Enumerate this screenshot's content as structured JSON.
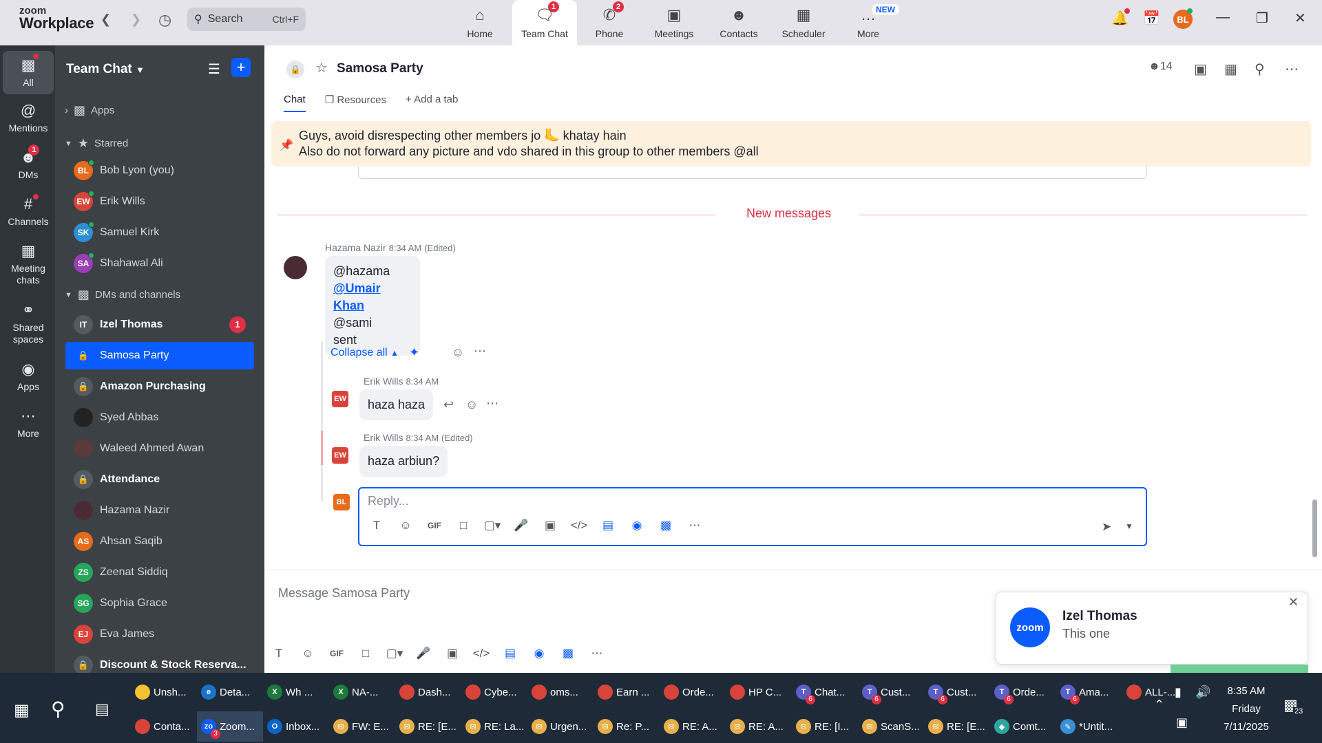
{
  "app": {
    "logo_top": "zoom",
    "logo_bottom": "Workplace"
  },
  "topbar": {
    "search_label": "Search",
    "search_shortcut": "Ctrl+F",
    "nav": [
      {
        "label": "Home",
        "icon": "home-icon",
        "badge": ""
      },
      {
        "label": "Team Chat",
        "icon": "chat-icon",
        "badge": "1"
      },
      {
        "label": "Phone",
        "icon": "phone-icon",
        "badge": "2"
      },
      {
        "label": "Meetings",
        "icon": "video-icon",
        "badge": ""
      },
      {
        "label": "Contacts",
        "icon": "contacts-icon",
        "badge": ""
      },
      {
        "label": "Scheduler",
        "icon": "calendar-icon",
        "badge": ""
      },
      {
        "label": "More",
        "icon": "more-icon",
        "badge": "",
        "tag": "NEW"
      }
    ],
    "avatar": "BL"
  },
  "rail": [
    {
      "label": "All",
      "icon": "chat-bubble-icon"
    },
    {
      "label": "Mentions",
      "icon": "at-icon"
    },
    {
      "label": "DMs",
      "icon": "people-icon",
      "badge": "1"
    },
    {
      "label": "Channels",
      "icon": "hash-icon"
    },
    {
      "label": "Meeting chats",
      "icon": "calendar-icon"
    },
    {
      "label": "Shared spaces",
      "icon": "share-icon"
    },
    {
      "label": "Apps",
      "icon": "apps-icon"
    },
    {
      "label": "More",
      "icon": "ellipsis-icon"
    }
  ],
  "sidebar": {
    "title": "Team Chat",
    "sections": {
      "apps": "Apps",
      "starred": "Starred",
      "dms": "DMs and channels"
    },
    "starred": [
      {
        "initials": "BL",
        "name": "Bob Lyon (you)",
        "color": "#e86a1b"
      },
      {
        "initials": "EW",
        "name": "Erik Wills",
        "color": "#d9443a"
      },
      {
        "initials": "SK",
        "name": "Samuel Kirk",
        "color": "#2d8fd5"
      },
      {
        "initials": "SA",
        "name": "Shahawal Ali",
        "color": "#9b3fb5"
      }
    ],
    "dms": [
      {
        "initials": "IT",
        "name": "Izel Thomas",
        "color": "#555a5f",
        "bold": true,
        "badge": "1"
      },
      {
        "initials": "",
        "name": "Samosa Party",
        "color": "#0b5cff",
        "lock": true,
        "selected": true
      },
      {
        "initials": "",
        "name": "Amazon Purchasing",
        "color": "#555a5f",
        "lock": true,
        "bold": true
      },
      {
        "initials": "",
        "name": "Syed Abbas",
        "color": "#222222"
      },
      {
        "initials": "",
        "name": "Waleed Ahmed Awan",
        "color": "#5a3a3a"
      },
      {
        "initials": "",
        "name": "Attendance",
        "color": "#555a5f",
        "lock": true,
        "bold": true
      },
      {
        "initials": "",
        "name": "Hazama Nazir",
        "color": "#4a2a33"
      },
      {
        "initials": "AS",
        "name": "Ahsan Saqib",
        "color": "#e86a1b"
      },
      {
        "initials": "ZS",
        "name": "Zeenat Siddiq",
        "color": "#26a65b"
      },
      {
        "initials": "SG",
        "name": "Sophia Grace",
        "color": "#26a65b"
      },
      {
        "initials": "EJ",
        "name": "Eva James",
        "color": "#d9443a"
      },
      {
        "initials": "",
        "name": "Discount & Stock Reserva...",
        "color": "#555a5f",
        "lock": true,
        "bold": true
      }
    ]
  },
  "channel": {
    "title": "Samosa Party",
    "members": "14",
    "tabs": [
      "Chat",
      "Resources",
      "Add a tab"
    ],
    "pinned_line1": "Guys, avoid disrespecting other members jo 🦶 khatay hain",
    "pinned_line2": "Also do not forward any picture and vdo shared in this group to other members @all",
    "new_messages": "New messages"
  },
  "messages": {
    "m1": {
      "sender": "Hazama Nazir",
      "time": "8:34 AM",
      "edited": "(Edited)",
      "l1": "@hazama",
      "l2": "@Umair Khan",
      "l3": "@sami",
      "l4": "sent"
    },
    "collapse": "Collapse all",
    "r1": {
      "initials": "EW",
      "sender": "Erik Wills",
      "time": "8:34 AM",
      "text": "haza haza"
    },
    "r2": {
      "initials": "EW",
      "sender": "Erik Wills",
      "time": "8:34 AM",
      "edited": "(Edited)",
      "text": "haza arbiun?"
    },
    "reply_avatar": "BL",
    "reply_placeholder": "Reply...",
    "gif": "GIF",
    "compose_placeholder": "Message Samosa Party"
  },
  "toast": {
    "logo": "zoom",
    "name": "Izel Thomas",
    "text": "This one"
  },
  "taskbar": {
    "row1": [
      {
        "label": "Unsh...",
        "color": "#f2c230",
        "txt": ""
      },
      {
        "label": "Deta...",
        "color": "#1a73c8",
        "txt": "e"
      },
      {
        "label": "Wh ...",
        "color": "#1d7a3a",
        "txt": "X"
      },
      {
        "label": "NA-...",
        "color": "#1d7a3a",
        "txt": "X"
      },
      {
        "label": "Dash...",
        "color": "#d9443a",
        "txt": ""
      },
      {
        "label": "Cybe...",
        "color": "#d9443a",
        "txt": ""
      },
      {
        "label": "oms...",
        "color": "#d9443a",
        "txt": ""
      },
      {
        "label": "Earn ...",
        "color": "#d9443a",
        "txt": ""
      },
      {
        "label": "Orde...",
        "color": "#d9443a",
        "txt": ""
      },
      {
        "label": "HP C...",
        "color": "#d9443a",
        "txt": ""
      },
      {
        "label": "Chat...",
        "color": "#5b5fc7",
        "txt": "T",
        "n": "6"
      },
      {
        "label": "Cust...",
        "color": "#5b5fc7",
        "txt": "T",
        "n": "6"
      },
      {
        "label": "Cust...",
        "color": "#5b5fc7",
        "txt": "T",
        "n": "6"
      },
      {
        "label": "Orde...",
        "color": "#5b5fc7",
        "txt": "T",
        "n": "6"
      },
      {
        "label": "Ama...",
        "color": "#5b5fc7",
        "txt": "T",
        "n": "6"
      },
      {
        "label": "ALL-...",
        "color": "#d9443a",
        "txt": ""
      }
    ],
    "row2": [
      {
        "label": "Conta...",
        "color": "#d9443a",
        "txt": ""
      },
      {
        "label": "Zoom...",
        "color": "#0b5cff",
        "txt": "zo",
        "n": "3",
        "active": true
      },
      {
        "label": "Inbox...",
        "color": "#0a64c9",
        "txt": "O"
      },
      {
        "label": "FW: E...",
        "color": "#e8b04a",
        "txt": "✉"
      },
      {
        "label": "RE: [E...",
        "color": "#e8b04a",
        "txt": "✉"
      },
      {
        "label": "RE: La...",
        "color": "#e8b04a",
        "txt": "✉"
      },
      {
        "label": "Urgen...",
        "color": "#e8b04a",
        "txt": "✉"
      },
      {
        "label": "Re: P...",
        "color": "#e8b04a",
        "txt": "✉"
      },
      {
        "label": "RE: A...",
        "color": "#e8b04a",
        "txt": "✉"
      },
      {
        "label": "RE: A...",
        "color": "#e8b04a",
        "txt": "✉"
      },
      {
        "label": "RE: [I...",
        "color": "#e8b04a",
        "txt": "✉"
      },
      {
        "label": "ScanS...",
        "color": "#e8b04a",
        "txt": "✉"
      },
      {
        "label": "RE: [E...",
        "color": "#e8b04a",
        "txt": "✉"
      },
      {
        "label": "Comt...",
        "color": "#2aa8a0",
        "txt": "◆"
      },
      {
        "label": "*Untit...",
        "color": "#3a8fd5",
        "txt": "✎"
      }
    ],
    "time": "8:35 AM",
    "day": "Friday",
    "date": "7/11/2025",
    "notifications": "23"
  }
}
